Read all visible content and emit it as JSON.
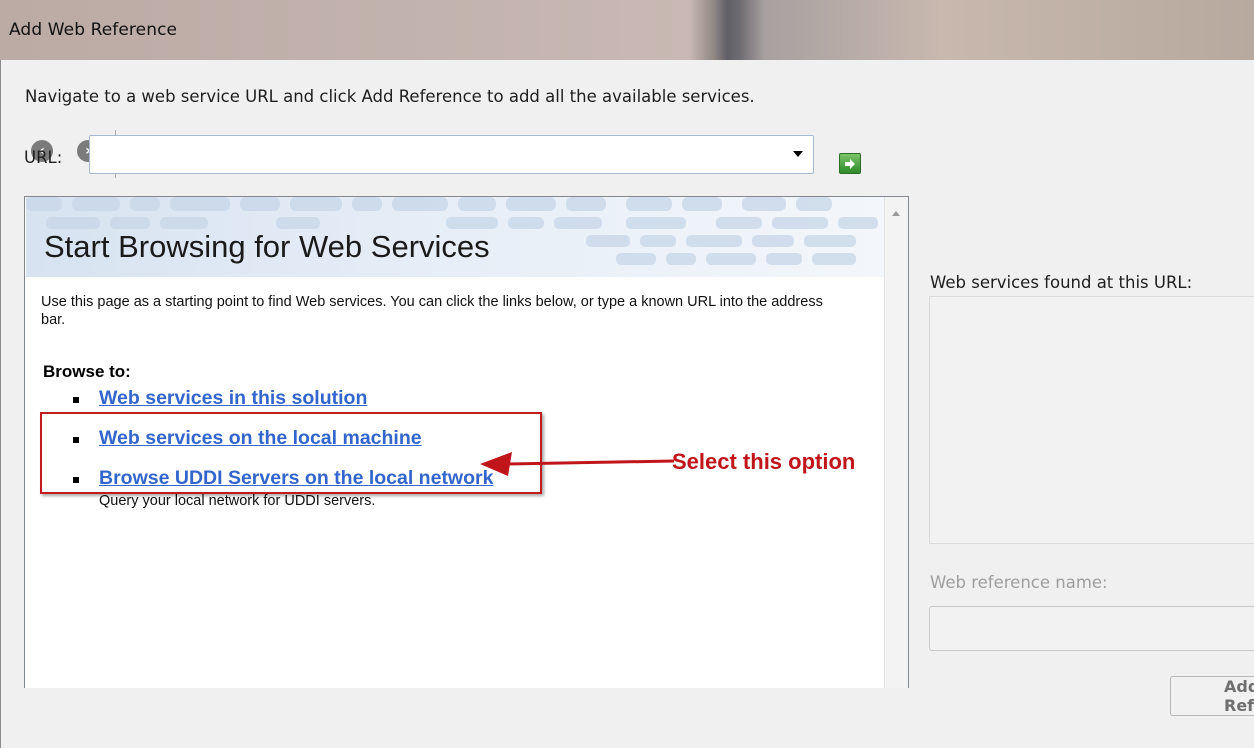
{
  "window": {
    "title": "Add Web Reference"
  },
  "instructions": "Navigate to a web service URL and click Add Reference to add all the available services.",
  "toolbar": {
    "back_icon": "back-arrow-icon",
    "forward_icon": "forward-arrow-icon",
    "stop_icon": "stop-icon",
    "refresh_icon": "refresh-icon",
    "home_icon": "home-icon"
  },
  "url": {
    "label": "URL:",
    "value": "",
    "go_icon": "go-arrow-icon"
  },
  "browser": {
    "title": "Start Browsing for Web Services",
    "intro": "Use this page as a starting point to find Web services. You can click the links below, or type a known URL into the address bar.",
    "browse_heading": "Browse to:",
    "links": [
      {
        "label": "Web services in this solution",
        "description": ""
      },
      {
        "label": "Web services on the local machine",
        "description": ""
      },
      {
        "label": "Browse UDDI Servers on the local network",
        "description": "Query your local network for UDDI servers."
      }
    ]
  },
  "annotation": {
    "label": "Select this option",
    "color": "#c0151a"
  },
  "right_panel": {
    "found_label": "Web services found at this URL:",
    "reference_name_label": "Web reference name:",
    "reference_name_value": "",
    "add_button_label": "Add Reference"
  },
  "colors": {
    "link": "#3366cc",
    "annotation": "#c11b1b",
    "dialog_bg": "#f0f0f0"
  }
}
